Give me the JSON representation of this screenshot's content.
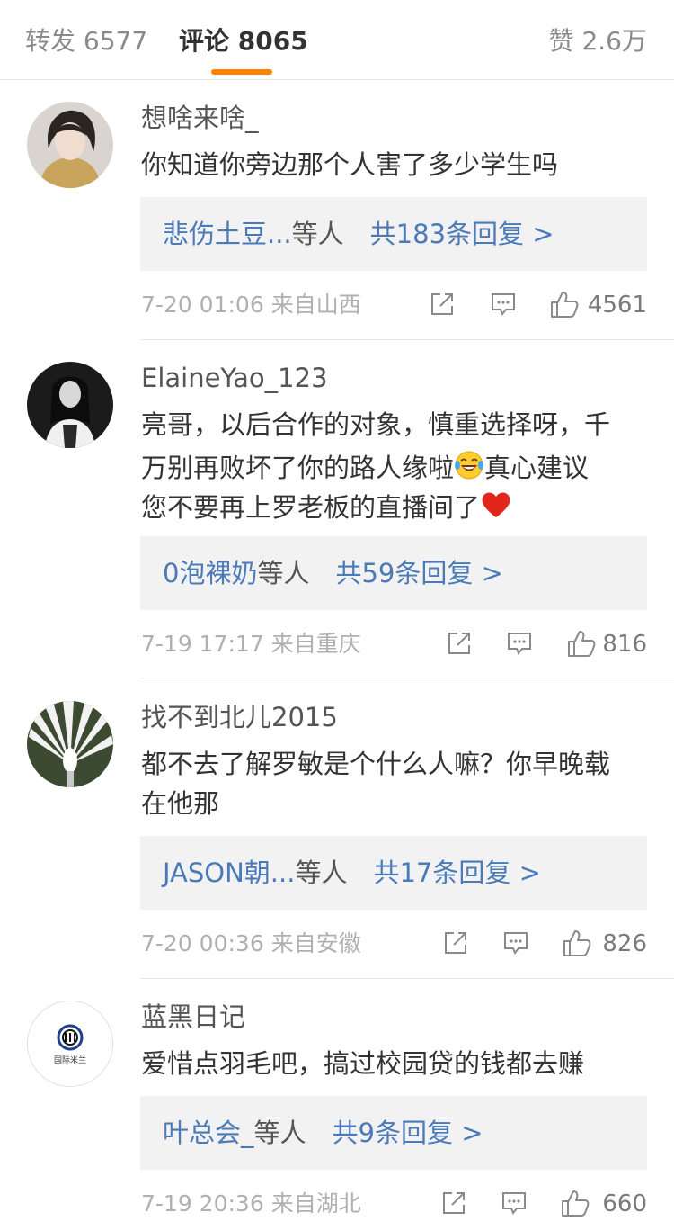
{
  "tabs": {
    "repost": "转发 6577",
    "comments": "评论 8065",
    "likes": "赞 2.6万"
  },
  "comments": [
    {
      "username": "想啥来啥_",
      "text": "你知道你旁边那个人害了多少学生吗",
      "reply_users": "悲伤土豆...",
      "reply_mid": "等人",
      "reply_count": "共183条回复 >",
      "time": "7-20 01:06",
      "source": "来自山西",
      "likes": "4561"
    },
    {
      "username": "ElaineYao_123",
      "text_line1": "亮哥，以后合作的对象，慎重选择呀，千",
      "text_line2": "万别再败坏了你的路人缘啦",
      "text_line2b": "真心建议",
      "text_line3": "您不要再上罗老板的直播间了",
      "reply_users": "0泡裸奶",
      "reply_mid": "等人",
      "reply_count": "共59条回复 >",
      "time": "7-19 17:17",
      "source": "来自重庆",
      "likes": "816"
    },
    {
      "username": "找不到北儿2015",
      "text_line1": "都不去了解罗敏是个什么人嘛？你早晚载",
      "text_line2": "在他那",
      "reply_users": "JASON朝...",
      "reply_mid": "等人",
      "reply_count": "共17条回复 >",
      "time": "7-20 00:36",
      "source": "来自安徽",
      "likes": "826"
    },
    {
      "username": "蓝黑日记",
      "text": "爱惜点羽毛吧，搞过校园贷的钱都去赚",
      "avatar_caption": "国际米兰",
      "reply_users": "叶总会_",
      "reply_mid": "等人",
      "reply_count": "共9条回复 >",
      "time": "7-19 20:36",
      "source": "来自湖北",
      "likes": "660"
    }
  ],
  "icons": {
    "repost": "share-icon",
    "reply": "comment-icon",
    "like": "thumbs-up-icon",
    "emoji_laugh": "laughing-tears-emoji",
    "emoji_heart": "red-heart-emoji"
  },
  "colors": {
    "accent": "#ff8200",
    "link": "#4a7ab8",
    "reply_bg": "#f2f2f2"
  }
}
